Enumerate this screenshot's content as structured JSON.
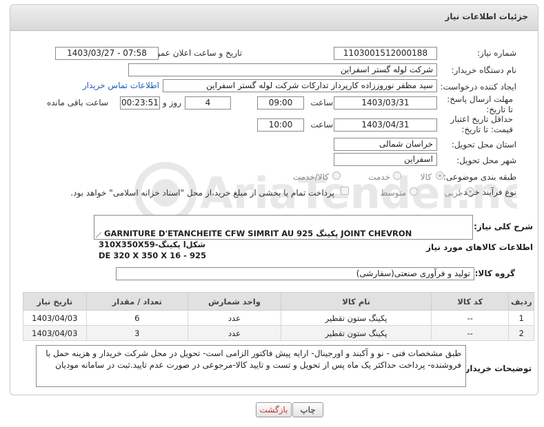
{
  "header": {
    "title": "جزئیات اطلاعات نیاز"
  },
  "fields": {
    "need_number_label": "شماره نیاز:",
    "need_number": "1103001512000188",
    "announce_label": "تاریخ و ساعت اعلان عمومی:",
    "announce_value": "1403/03/27 - 07:58",
    "buyer_label": "نام دستگاه خریدار:",
    "buyer_value": "شرکت لوله گستر اسفراین",
    "creator_label": "ایجاد کننده درخواست:",
    "creator_value": "سید مظفر نوروززاده کارپرداز تدارکات شرکت لوله گستر اسفراین",
    "contact_link": "اطلاعات تماس خریدار",
    "deadline_label": "مهلت ارسال پاسخ: تا تاریخ:",
    "deadline_date": "1403/03/31",
    "time_label": "ساعت",
    "deadline_time": "09:00",
    "days_value": "4",
    "days_label": "روز و",
    "remaining_time": "00:23:51",
    "remaining_label": "ساعت باقی مانده",
    "validity_label": "حداقل تاریخ اعتبار قیمت: تا تاریخ:",
    "validity_date": "1403/04/31",
    "validity_time_label": "ساعت",
    "validity_time": "10:00",
    "province_label": "استان محل تحویل:",
    "province_value": "خراسان شمالی",
    "city_label": "شهر محل تحویل:",
    "city_value": "اسفراین",
    "category_label": "طبقه بندی موضوعی:",
    "category_options": [
      "کالا",
      "خدمت",
      "کالا/خدمت"
    ],
    "process_label": "نوع فرآیند خرید :",
    "process_options": [
      "جزیی",
      "متوسط"
    ],
    "payment_note": "پرداخت تمام یا بخشی از مبلغ خرید،از محل \"اسناد خزانه اسلامی\" خواهد بود."
  },
  "general_desc": {
    "label": "شرح کلی نیاز:",
    "text": "GARNITURE D'ETANCHEITE CFW SIMRIT AU 925 پکینگ JOINT CHEVRON 310X350X59-پکینگ lشکل\nDE 320 X 350 X 16 - 925"
  },
  "goods_info": {
    "section_title": "اطلاعات کالاهای مورد نیاز",
    "group_label": "گروه کالا:",
    "group_value": "تولید و فرآوری صنعتی(سفارشی)"
  },
  "table": {
    "headers": [
      "ردیف",
      "کد کالا",
      "نام کالا",
      "واحد شمارش",
      "تعداد / مقدار",
      "تاریخ نیاز"
    ],
    "rows": [
      [
        "1",
        "--",
        "پکینگ ستون تقطیر",
        "عدد",
        "6",
        "1403/04/03"
      ],
      [
        "2",
        "--",
        "پکینگ ستون تقطیر",
        "عدد",
        "3",
        "1403/04/03"
      ]
    ]
  },
  "buyer_notes": {
    "label": "توضیحات خریدار:",
    "text": "طبق مشخصات فنی - نو و آکبند و اورجینال- ارایه پیش فاکتور الزامی است- تحویل در محل شرکت خریدار و هزینه حمل با فروشنده- پرداخت حداکثر یک ماه پس از تحویل و تست و تایید کالا-مرجوعی در صورت عدم تایید.ثبت در سامانه مودیان"
  },
  "buttons": {
    "print": "چاپ",
    "back": "بازگشت"
  },
  "watermark": {
    "text": "AriaTender.neT"
  },
  "colors": {
    "link": "#1a5fb4",
    "back_button_text": "#c0392b"
  }
}
